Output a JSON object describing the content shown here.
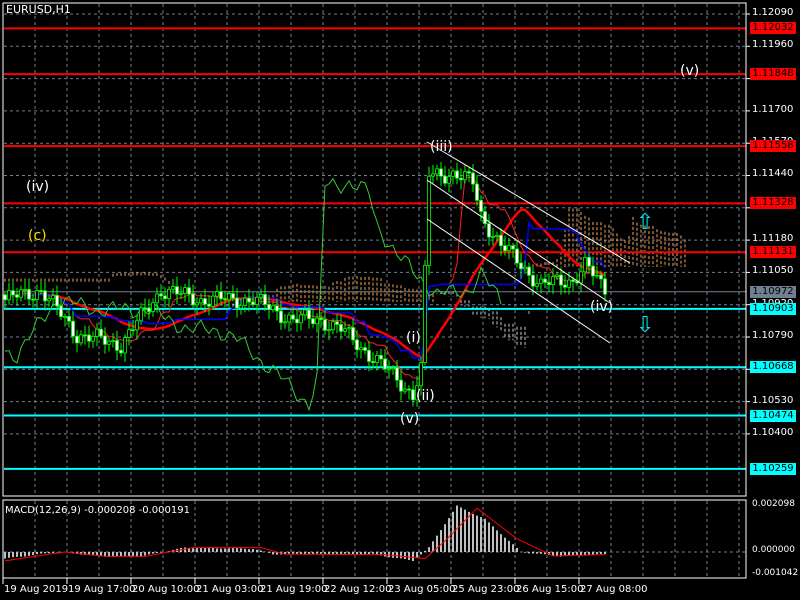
{
  "header": {
    "symbol_title": "EURUSD,H1"
  },
  "colors": {
    "resistance": "#ff0000",
    "support": "#00ffff",
    "current": "#708090",
    "candle": "#00ff00",
    "grid": "#708090"
  },
  "chart_data": {
    "type": "candlestick",
    "title": "EURUSD,H1",
    "timeframe": "H1",
    "ylim": [
      1.1021,
      1.1212
    ],
    "y_ticks": [
      "1.12090",
      "1.11960",
      "1.11830",
      "1.11700",
      "1.11570",
      "1.11440",
      "1.11310",
      "1.11180",
      "1.11050",
      "1.10920",
      "1.10790",
      "1.10660",
      "1.10530",
      "1.10400"
    ],
    "x_tick_labels": [
      "19 Aug 2019",
      "19 Aug 17:00",
      "20 Aug 10:00",
      "21 Aug 03:00",
      "21 Aug 19:00",
      "22 Aug 12:00",
      "23 Aug 05:00",
      "25 Aug 23:00",
      "26 Aug 15:00",
      "27 Aug 08:00"
    ],
    "current_price": "1.10972",
    "resistance_levels": [
      "1.12032",
      "1.11848",
      "1.11558",
      "1.11328",
      "1.11131"
    ],
    "support_levels": [
      "1.10903",
      "1.10668",
      "1.10474",
      "1.10259"
    ],
    "close_path_approx": [
      [
        0,
        1.1094
      ],
      [
        9,
        1.1098
      ],
      [
        18,
        1.108
      ],
      [
        29,
        1.1076
      ],
      [
        39,
        1.1098
      ],
      [
        49,
        1.1094
      ],
      [
        62,
        1.1094
      ],
      [
        72,
        1.1086
      ],
      [
        79,
        1.1086
      ],
      [
        84,
        1.1082
      ],
      [
        94,
        1.1068
      ],
      [
        102,
        1.1056
      ],
      [
        104,
        1.1066
      ],
      [
        106,
        1.1144
      ],
      [
        112,
        1.1145
      ],
      [
        117,
        1.1141
      ],
      [
        119,
        1.1128
      ],
      [
        124,
        1.1116
      ],
      [
        129,
        1.1108
      ],
      [
        134,
        1.11
      ],
      [
        142,
        1.1102
      ],
      [
        145,
        1.1108
      ],
      [
        150,
        1.1098
      ]
    ],
    "wave_labels": [
      {
        "text": "(iv)",
        "color": "#ffffff"
      },
      {
        "text": "(c)",
        "color": "#ffd700"
      },
      {
        "text": "(iii)",
        "color": "#ffffff"
      },
      {
        "text": "(i)",
        "color": "#ffffff"
      },
      {
        "text": "(ii)",
        "color": "#ffffff"
      },
      {
        "text": "(v)",
        "color": "#ffffff"
      },
      {
        "text": "(iv)",
        "color": "#ffffff"
      },
      {
        "text": "(v)",
        "color": "#ffffff"
      }
    ],
    "macd": {
      "label": "MACD(12,26,9) -0.000208 -0.000191",
      "ylim": [
        -0.001042,
        0.002098
      ],
      "y_ticks": [
        "0.002098",
        "0.000000",
        "-0.001042"
      ],
      "histogram_path_approx": [
        [
          0,
          -0.0003
        ],
        [
          13,
          0.0
        ],
        [
          25,
          -0.0002
        ],
        [
          34,
          -0.0002
        ],
        [
          45,
          0.0002
        ],
        [
          62,
          0.00015
        ],
        [
          67,
          -0.0001
        ],
        [
          92,
          -0.0001
        ],
        [
          102,
          -0.0004
        ],
        [
          106,
          0.0002
        ],
        [
          113,
          0.0021
        ],
        [
          120,
          0.0015
        ],
        [
          129,
          0.0
        ],
        [
          139,
          -0.0002
        ],
        [
          150,
          -0.0001
        ]
      ],
      "signal_path_approx": [
        [
          0,
          -0.0004
        ],
        [
          15,
          0.0
        ],
        [
          25,
          -0.0002
        ],
        [
          35,
          -0.0002
        ],
        [
          47,
          0.0002
        ],
        [
          64,
          0.0002
        ],
        [
          70,
          -0.0001
        ],
        [
          95,
          -0.00012
        ],
        [
          105,
          -0.0003
        ],
        [
          110,
          0.0005
        ],
        [
          118,
          0.002
        ],
        [
          128,
          0.0006
        ],
        [
          137,
          -0.00018
        ],
        [
          150,
          -0.00012
        ]
      ]
    }
  }
}
